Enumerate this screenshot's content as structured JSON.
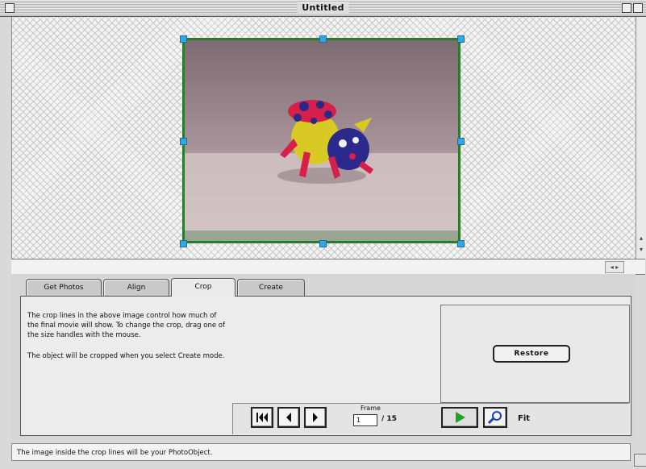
{
  "window": {
    "title": "Untitled"
  },
  "tabs": [
    {
      "label": "Get Photos",
      "active": false
    },
    {
      "label": "Align",
      "active": false
    },
    {
      "label": "Crop",
      "active": true
    },
    {
      "label": "Create",
      "active": false
    }
  ],
  "crop_panel": {
    "instructions_1": "The crop lines in the above image control how much of the final movie will show. To change the crop, drag one of the size handles with the mouse.",
    "instructions_2": "The object will be cropped when you select Create mode.",
    "restore_label": "Restore"
  },
  "controls": {
    "frame_label": "Frame",
    "frame_value": "1",
    "frame_total": "/ 15",
    "fit_label": "Fit"
  },
  "status": {
    "message": "The image inside the crop lines will be your PhotoObject."
  },
  "colors": {
    "crop_border": "#2c7a2c",
    "handle": "#2fa8e8",
    "play": "#1fa51f",
    "zoom": "#1a3fbf"
  },
  "icons": [
    "first-frame-icon",
    "previous-frame-icon",
    "next-frame-icon",
    "play-icon",
    "zoom-icon",
    "scroll-arrows-icon"
  ]
}
